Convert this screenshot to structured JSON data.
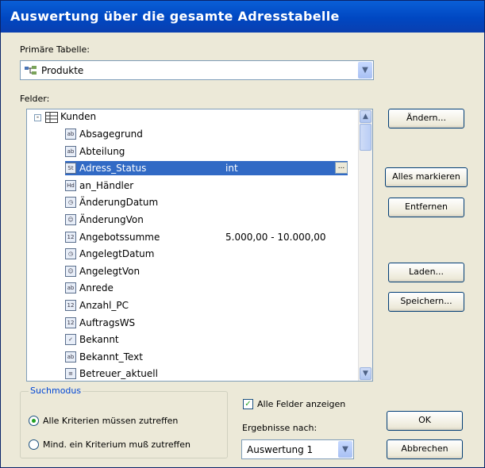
{
  "window": {
    "title": "Auswertung über die gesamte Adresstabelle"
  },
  "primary": {
    "label": "Primäre Tabelle:",
    "value": "Produkte"
  },
  "fields": {
    "label": "Felder:",
    "root": "Kunden",
    "items": [
      {
        "name": "Absagegrund",
        "icon": "text-field-icon",
        "value": ""
      },
      {
        "name": "Abteilung",
        "icon": "text-field-icon",
        "value": ""
      },
      {
        "name": "Adress_Status",
        "icon": "status-field-icon",
        "value": "int",
        "selected": true
      },
      {
        "name": "an_Händler",
        "icon": "flag-field-icon",
        "value": ""
      },
      {
        "name": "ÄnderungDatum",
        "icon": "clock-field-icon",
        "value": ""
      },
      {
        "name": "ÄnderungVon",
        "icon": "user-field-icon",
        "value": ""
      },
      {
        "name": "Angebotssumme",
        "icon": "number-field-icon",
        "value": "5.000,00 - 10.000,00"
      },
      {
        "name": "AngelegtDatum",
        "icon": "clock-field-icon",
        "value": ""
      },
      {
        "name": "AngelegtVon",
        "icon": "user-field-icon",
        "value": ""
      },
      {
        "name": "Anrede",
        "icon": "text-field-icon",
        "value": ""
      },
      {
        "name": "Anzahl_PC",
        "icon": "number-field-icon",
        "value": ""
      },
      {
        "name": "AuftragsWS",
        "icon": "number-field-icon",
        "value": ""
      },
      {
        "name": "Bekannt",
        "icon": "checkbox-field-icon",
        "value": ""
      },
      {
        "name": "Bekannt_Text",
        "icon": "text-field-icon",
        "value": ""
      },
      {
        "name": "Betreuer_aktuell",
        "icon": "list-field-icon",
        "value": ""
      }
    ]
  },
  "buttons": {
    "aendern": "Ändern...",
    "alles": "Alles markieren",
    "entfernen": "Entfernen",
    "laden": "Laden...",
    "speichern": "Speichern...",
    "ok": "OK",
    "abbrechen": "Abbrechen"
  },
  "suchmodus": {
    "title": "Suchmodus",
    "option1": "Alle Kriterien müssen zutreffen",
    "option2": "Mind. ein Kriterium muß zutreffen"
  },
  "show_all": "Alle Felder anzeigen",
  "results": {
    "label": "Ergebnisse nach:",
    "value": "Auswertung 1"
  }
}
